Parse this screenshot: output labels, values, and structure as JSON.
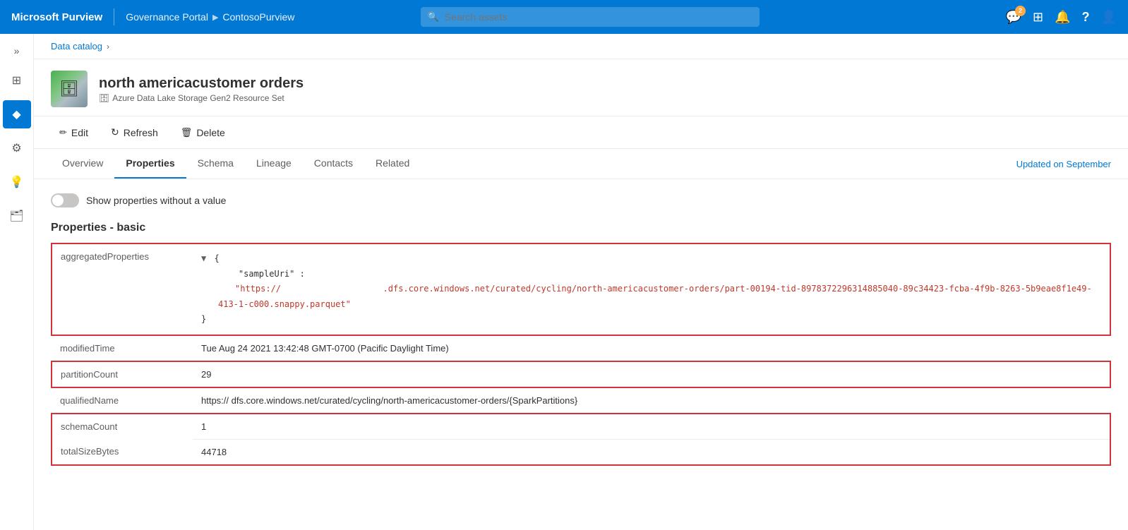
{
  "app": {
    "brand": "Microsoft Purview",
    "nav_divider": "|",
    "portal_label": "Governance Portal",
    "breadcrumb_chevron": "▶",
    "portal_name": "ContosoPurview"
  },
  "search": {
    "placeholder": "Search assets"
  },
  "top_actions": {
    "badge_count": "2",
    "comment_icon": "💬",
    "grid_icon": "⊞",
    "bell_icon": "🔔",
    "help_icon": "?",
    "user_icon": "👤"
  },
  "sidebar": {
    "toggle_icon": "»",
    "items": [
      {
        "icon": "⊞",
        "label": "Home",
        "active": false
      },
      {
        "icon": "◆",
        "label": "Data Catalog",
        "active": true
      },
      {
        "icon": "⚙",
        "label": "Settings",
        "active": false
      },
      {
        "icon": "💡",
        "label": "Insights",
        "active": false
      },
      {
        "icon": "🗂",
        "label": "Management",
        "active": false
      }
    ]
  },
  "breadcrumb": {
    "link_text": "Data catalog",
    "chevron": "›"
  },
  "asset": {
    "title": "north americacustomer orders",
    "type": "Azure Data Lake Storage Gen2 Resource Set",
    "type_icon": "🗄"
  },
  "toolbar": {
    "edit_label": "Edit",
    "edit_icon": "✏",
    "refresh_label": "Refresh",
    "refresh_icon": "↻",
    "delete_label": "Delete",
    "delete_icon": "🗑"
  },
  "tabs": [
    {
      "label": "Overview",
      "active": false
    },
    {
      "label": "Properties",
      "active": true
    },
    {
      "label": "Schema",
      "active": false
    },
    {
      "label": "Lineage",
      "active": false
    },
    {
      "label": "Contacts",
      "active": false
    },
    {
      "label": "Related",
      "active": false
    }
  ],
  "tab_updated": "Updated on September",
  "properties": {
    "toggle_label": "Show properties without a value",
    "section_title": "Properties - basic",
    "rows": [
      {
        "name": "aggregatedProperties",
        "type": "json",
        "highlighted": true,
        "json_content": {
          "open_brace": "{",
          "key": "\"sampleUri\" :",
          "url": "\"https://                    .dfs.core.windows.net/curated/cycling/north-americacustomer-orders/part-00194-tid-8978372296314885040-89c34423-fcba-4f9b-8263-5b9eae8f1e49-413-1-c000.snappy.parquet\"",
          "close_brace": "}"
        }
      },
      {
        "name": "modifiedTime",
        "type": "text",
        "highlighted": false,
        "value": "Tue Aug 24 2021 13:42:48 GMT-0700 (Pacific Daylight Time)"
      },
      {
        "name": "partitionCount",
        "type": "text",
        "highlighted": true,
        "value": "29"
      },
      {
        "name": "qualifiedName",
        "type": "text",
        "highlighted": false,
        "value": "https://                   dfs.core.windows.net/curated/cycling/north-americacustomer-orders/{SparkPartitions}"
      },
      {
        "name": "schemaCount",
        "type": "text",
        "highlighted": true,
        "value": "1"
      },
      {
        "name": "totalSizeBytes",
        "type": "text",
        "highlighted": true,
        "value": "44718"
      }
    ]
  }
}
